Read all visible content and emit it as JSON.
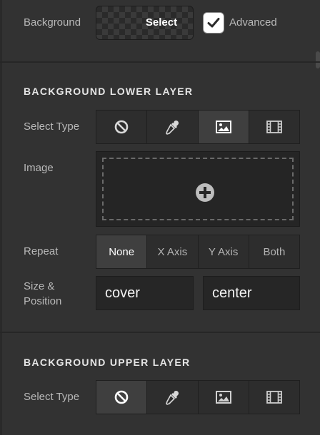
{
  "top": {
    "background_label": "Background",
    "select_label": "Select",
    "advanced_label": "Advanced",
    "advanced_checked": true
  },
  "lower_layer": {
    "title": "BACKGROUND LOWER LAYER",
    "select_type_label": "Select Type",
    "types": [
      {
        "icon": "none-icon",
        "active": false
      },
      {
        "icon": "eyedropper-icon",
        "active": false
      },
      {
        "icon": "image-icon",
        "active": true
      },
      {
        "icon": "film-icon",
        "active": false
      }
    ],
    "image_label": "Image",
    "repeat_label": "Repeat",
    "repeat_options": [
      "None",
      "X Axis",
      "Y Axis",
      "Both"
    ],
    "repeat_selected": "None",
    "size_position_label": "Size &\nPosition",
    "size_value": "cover",
    "position_value": "center"
  },
  "upper_layer": {
    "title": "BACKGROUND UPPER LAYER",
    "select_type_label": "Select Type",
    "types": [
      {
        "icon": "none-icon",
        "active": true
      },
      {
        "icon": "eyedropper-icon",
        "active": false
      },
      {
        "icon": "image-icon",
        "active": false
      },
      {
        "icon": "film-icon",
        "active": false
      }
    ]
  }
}
